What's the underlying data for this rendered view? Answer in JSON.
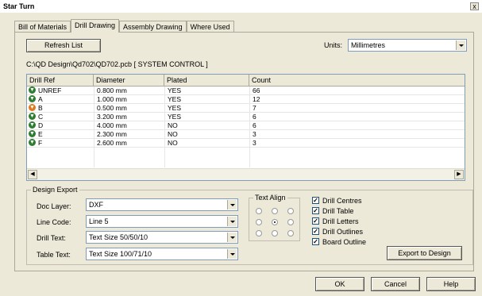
{
  "window": {
    "title": "Star Turn",
    "close_glyph": "x"
  },
  "tabs": [
    {
      "label": "Bill of Materials",
      "active": false
    },
    {
      "label": "Drill Drawing",
      "active": true
    },
    {
      "label": "Assembly Drawing",
      "active": false
    },
    {
      "label": "Where Used",
      "active": false
    }
  ],
  "toolbar": {
    "refresh_label": "Refresh List",
    "units_label": "Units:",
    "units_value": "Millimetres"
  },
  "file_path": "C:\\QD Design\\Qd702\\QD702.pcb [ SYSTEM CONTROL ]",
  "grid": {
    "headers": [
      "Drill Ref",
      "Diameter",
      "Plated",
      "Count"
    ],
    "rows": [
      {
        "icon": "drill-green-icon",
        "icon_color": "#2f7d32",
        "ref": "UNREF",
        "diameter": "0.800 mm",
        "plated": "YES",
        "count": "66"
      },
      {
        "icon": "drill-green-icon",
        "icon_color": "#2f7d32",
        "ref": "A",
        "diameter": "1.000 mm",
        "plated": "YES",
        "count": "12"
      },
      {
        "icon": "drill-orange-icon",
        "icon_color": "#e07a1f",
        "ref": "B",
        "diameter": "0.500 mm",
        "plated": "YES",
        "count": "7"
      },
      {
        "icon": "drill-green-icon",
        "icon_color": "#2f7d32",
        "ref": "C",
        "diameter": "3.200 mm",
        "plated": "YES",
        "count": "6"
      },
      {
        "icon": "drill-green-icon",
        "icon_color": "#2f7d32",
        "ref": "D",
        "diameter": "4.000 mm",
        "plated": "NO",
        "count": "6"
      },
      {
        "icon": "drill-green-icon",
        "icon_color": "#2f7d32",
        "ref": "E",
        "diameter": "2.300 mm",
        "plated": "NO",
        "count": "3"
      },
      {
        "icon": "drill-green-icon",
        "icon_color": "#2f7d32",
        "ref": "F",
        "diameter": "2.600 mm",
        "plated": "NO",
        "count": "3"
      }
    ]
  },
  "design_export": {
    "legend": "Design Export",
    "doc_layer_label": "Doc Layer:",
    "doc_layer_value": "DXF",
    "line_code_label": "Line Code:",
    "line_code_value": "Line 5",
    "drill_text_label": "Drill Text:",
    "drill_text_value": "Text Size 50/50/10",
    "table_text_label": "Table Text:",
    "table_text_value": "Text Size 100/71/10",
    "text_align_legend": "Text Align",
    "text_align_selected": "middle-center",
    "checkboxes": [
      {
        "label": "Drill Centres",
        "checked": true
      },
      {
        "label": "Drill Table",
        "checked": true
      },
      {
        "label": "Drill Letters",
        "checked": true
      },
      {
        "label": "Drill Outlines",
        "checked": true
      },
      {
        "label": "Board Outline",
        "checked": true
      }
    ],
    "export_label": "Export to Design"
  },
  "footer": {
    "ok_label": "OK",
    "cancel_label": "Cancel",
    "help_label": "Help"
  }
}
